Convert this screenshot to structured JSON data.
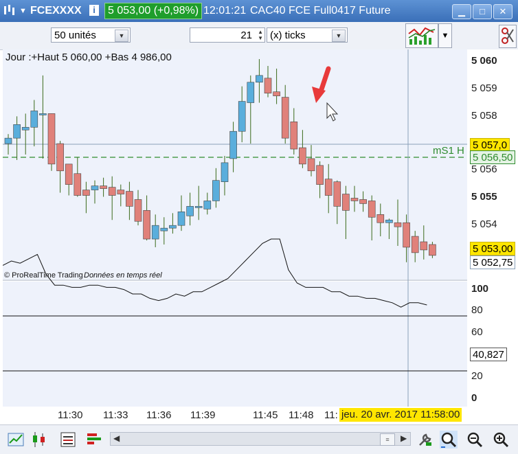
{
  "window": {
    "symbol": "FCEXXXX",
    "price_change": "5 053,00 (+0,98%)",
    "time": "12:01:21",
    "instrument": "CAC40 FCE Full0417 Future"
  },
  "toolbar": {
    "units_select": "50 unités",
    "tick_count": "21",
    "tick_mode": "(x) ticks"
  },
  "price_panel": {
    "info": "Jour :+Haut 5 060,00 +Bas 4 986,00",
    "credit": "© ProRealTime Trading",
    "realtime": "Données en temps réel",
    "ms1_label": "mS1 H",
    "y_ticks": [
      "5 060",
      "5 059",
      "5 058",
      "5 057,0",
      "5 056,50",
      "5 056",
      "5 055",
      "5 054",
      "5 053,00",
      "5 052,75"
    ],
    "tag_last": "5 057,0",
    "tag_ms1": "5 056,50",
    "tag_price": "5 053,00",
    "tag_cursor": "5 052,75"
  },
  "indicator_panel": {
    "y_ticks": [
      "100",
      "80",
      "60",
      "40",
      "20",
      "0"
    ],
    "value_tag": "40,827",
    "levels": [
      75,
      25
    ],
    "ylim": [
      0,
      100
    ]
  },
  "x_axis": {
    "labels": [
      "11:30",
      "11:33",
      "11:36",
      "11:39",
      "11:45",
      "11:48",
      "11:"
    ],
    "cursor_date": "jeu. 20 avr. 2017 11:58:00"
  },
  "colors": {
    "up": "#5aaedc",
    "down": "#e0817a",
    "wick": "#3a6a1a",
    "title_blue": "#3a6fb8",
    "badge_green": "#1f9e2c",
    "dashed_green": "#2e8b2e",
    "tag_yellow": "#ffe600"
  },
  "chart_data": {
    "type": "candlestick",
    "candles": [
      [
        5056.95,
        5057.3,
        5056.55,
        5057.15
      ],
      [
        5057.15,
        5057.95,
        5056.35,
        5057.65
      ],
      [
        5057.45,
        5058.05,
        5056.55,
        5057.55
      ],
      [
        5057.55,
        5058.55,
        5056.85,
        5058.15
      ],
      [
        5058.0,
        5059.45,
        5056.4,
        5058.05
      ],
      [
        5058.05,
        5058.05,
        5055.95,
        5056.2
      ],
      [
        5056.95,
        5057.05,
        5055.15,
        5055.95
      ],
      [
        5056.2,
        5056.2,
        5055.05,
        5055.45
      ],
      [
        5055.85,
        5056.45,
        5055.0,
        5055.05
      ],
      [
        5055.25,
        5055.55,
        5054.4,
        5055.05
      ],
      [
        5055.25,
        5055.6,
        5054.75,
        5055.4
      ],
      [
        5055.4,
        5055.7,
        5055.0,
        5055.3
      ],
      [
        5055.35,
        5055.75,
        5054.15,
        5055.05
      ],
      [
        5055.25,
        5055.45,
        5054.65,
        5055.1
      ],
      [
        5055.2,
        5055.55,
        5054.15,
        5054.65
      ],
      [
        5054.9,
        5055.25,
        5053.95,
        5054.1
      ],
      [
        5054.5,
        5055.05,
        5053.4,
        5053.45
      ],
      [
        5053.45,
        5054.35,
        5053.15,
        5053.95
      ],
      [
        5053.75,
        5054.25,
        5053.25,
        5053.85
      ],
      [
        5053.85,
        5054.4,
        5053.65,
        5053.95
      ],
      [
        5053.95,
        5055.05,
        5053.75,
        5054.45
      ],
      [
        5054.3,
        5055.15,
        5053.95,
        5054.65
      ],
      [
        5054.6,
        5055.4,
        5054.15,
        5054.65
      ],
      [
        5054.55,
        5055.15,
        5054.35,
        5054.85
      ],
      [
        5054.85,
        5056.05,
        5054.6,
        5055.6
      ],
      [
        5055.55,
        5056.5,
        5055.05,
        5056.25
      ],
      [
        5056.4,
        5057.75,
        5055.9,
        5057.4
      ],
      [
        5057.4,
        5059.05,
        5057.0,
        5058.5
      ],
      [
        5058.45,
        5059.45,
        5056.95,
        5059.2
      ],
      [
        5059.2,
        5060.05,
        5058.45,
        5059.45
      ],
      [
        5059.35,
        5059.8,
        5058.65,
        5058.8
      ],
      [
        5058.85,
        5059.7,
        5058.4,
        5058.7
      ],
      [
        5058.65,
        5059.1,
        5056.95,
        5057.15
      ],
      [
        5057.75,
        5058.25,
        5056.55,
        5056.75
      ],
      [
        5056.8,
        5057.45,
        5056.05,
        5056.2
      ],
      [
        5056.4,
        5056.9,
        5055.75,
        5055.95
      ],
      [
        5056.15,
        5056.3,
        5054.95,
        5055.45
      ],
      [
        5055.65,
        5056.2,
        5054.4,
        5055.05
      ],
      [
        5055.55,
        5055.6,
        5054.0,
        5054.65
      ],
      [
        5055.1,
        5055.4,
        5053.45,
        5054.5
      ],
      [
        5054.95,
        5055.4,
        5054.45,
        5054.85
      ],
      [
        5054.9,
        5055.2,
        5054.45,
        5054.75
      ],
      [
        5054.85,
        5055.05,
        5053.4,
        5054.25
      ],
      [
        5054.35,
        5054.75,
        5053.55,
        5054.05
      ],
      [
        5054.05,
        5054.2,
        5053.45,
        5054.15
      ],
      [
        5054.05,
        5054.9,
        5053.2,
        5053.9
      ],
      [
        5054.05,
        5054.35,
        5052.6,
        5053.15
      ],
      [
        5053.55,
        5053.75,
        5052.6,
        5052.95
      ],
      [
        5053.35,
        5053.95,
        5052.7,
        5053.05
      ],
      [
        5053.25,
        5053.35,
        5052.75,
        5052.85
      ]
    ],
    "indicator": [
      58,
      60,
      59,
      61,
      63,
      54,
      49,
      49,
      48,
      48,
      49,
      49,
      48,
      48,
      47,
      45,
      45,
      43,
      42,
      43,
      45,
      44,
      46,
      46,
      48,
      50,
      52,
      56,
      60,
      64,
      68,
      70,
      70,
      56,
      50,
      48,
      48,
      48,
      46,
      46,
      44,
      44,
      43,
      43,
      42,
      41,
      39,
      41,
      41,
      40
    ]
  }
}
